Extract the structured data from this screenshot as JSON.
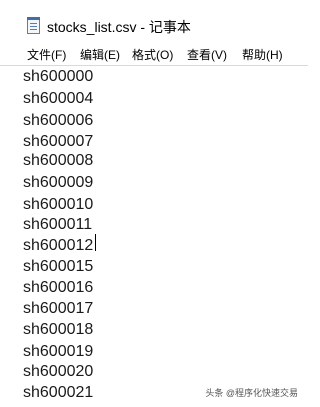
{
  "window": {
    "title": "stocks_list.csv - 记事本",
    "icon": "notepad-icon"
  },
  "menu": {
    "items": [
      {
        "label": "文件(F)"
      },
      {
        "label": "编辑(E)"
      },
      {
        "label": "格式(O)"
      },
      {
        "label": "查看(V)"
      },
      {
        "label": "帮助(H)"
      }
    ]
  },
  "editor": {
    "lines": [
      "sh600000",
      "sh600004",
      "sh600006",
      "sh600007",
      "sh600008",
      "sh600009",
      "sh600010",
      "sh600011",
      "sh600012",
      "sh600015",
      "sh600016",
      "sh600017",
      "sh600018",
      "sh600019",
      "sh600020",
      "sh600021"
    ]
  },
  "watermark": {
    "text": "头条 @程序化快速交易"
  }
}
